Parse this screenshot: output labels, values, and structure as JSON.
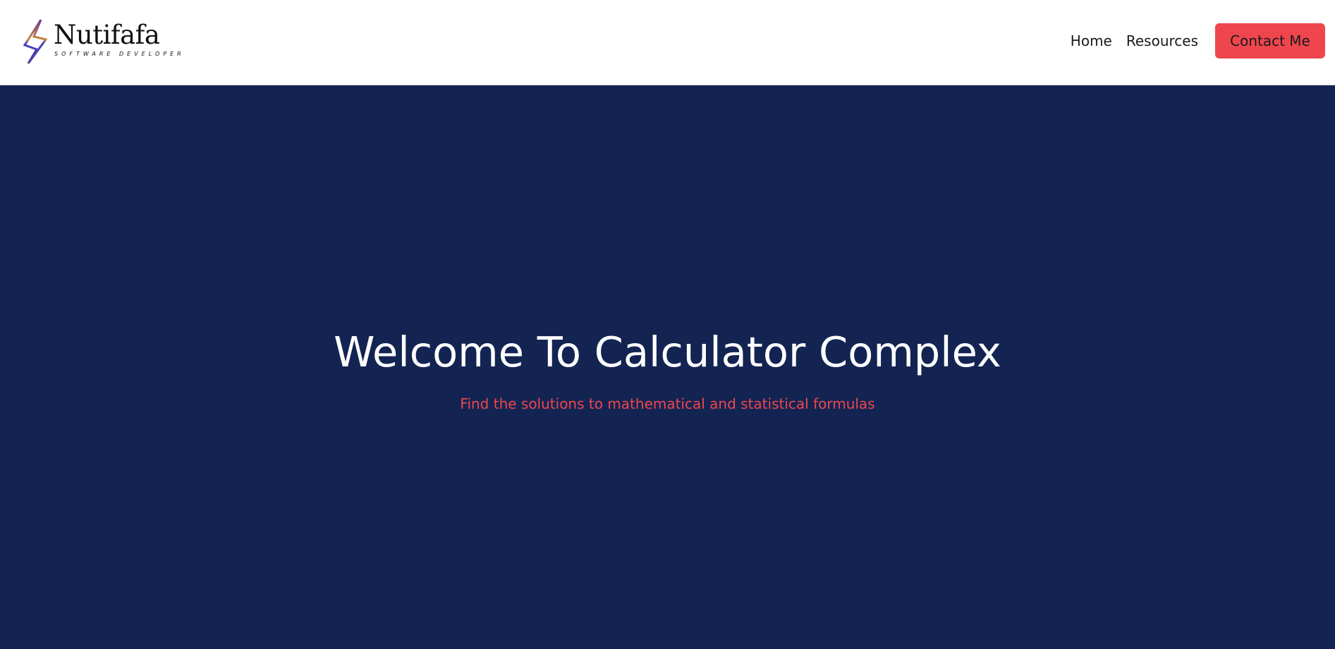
{
  "header": {
    "logo": {
      "icon": "lightning-bolt-icon",
      "name": "Nutifafa",
      "tagline": "SOFTWARE DEVELOPER"
    },
    "nav": {
      "home_label": "Home",
      "resources_label": "Resources",
      "contact_label": "Contact Me"
    }
  },
  "hero": {
    "title": "Welcome To Calculator Complex",
    "subtitle": "Find the solutions to mathematical and statistical formulas"
  },
  "colors": {
    "hero_background": "#132453",
    "accent": "#ef464d",
    "header_background": "#ffffff",
    "title_text": "#ffffff"
  }
}
